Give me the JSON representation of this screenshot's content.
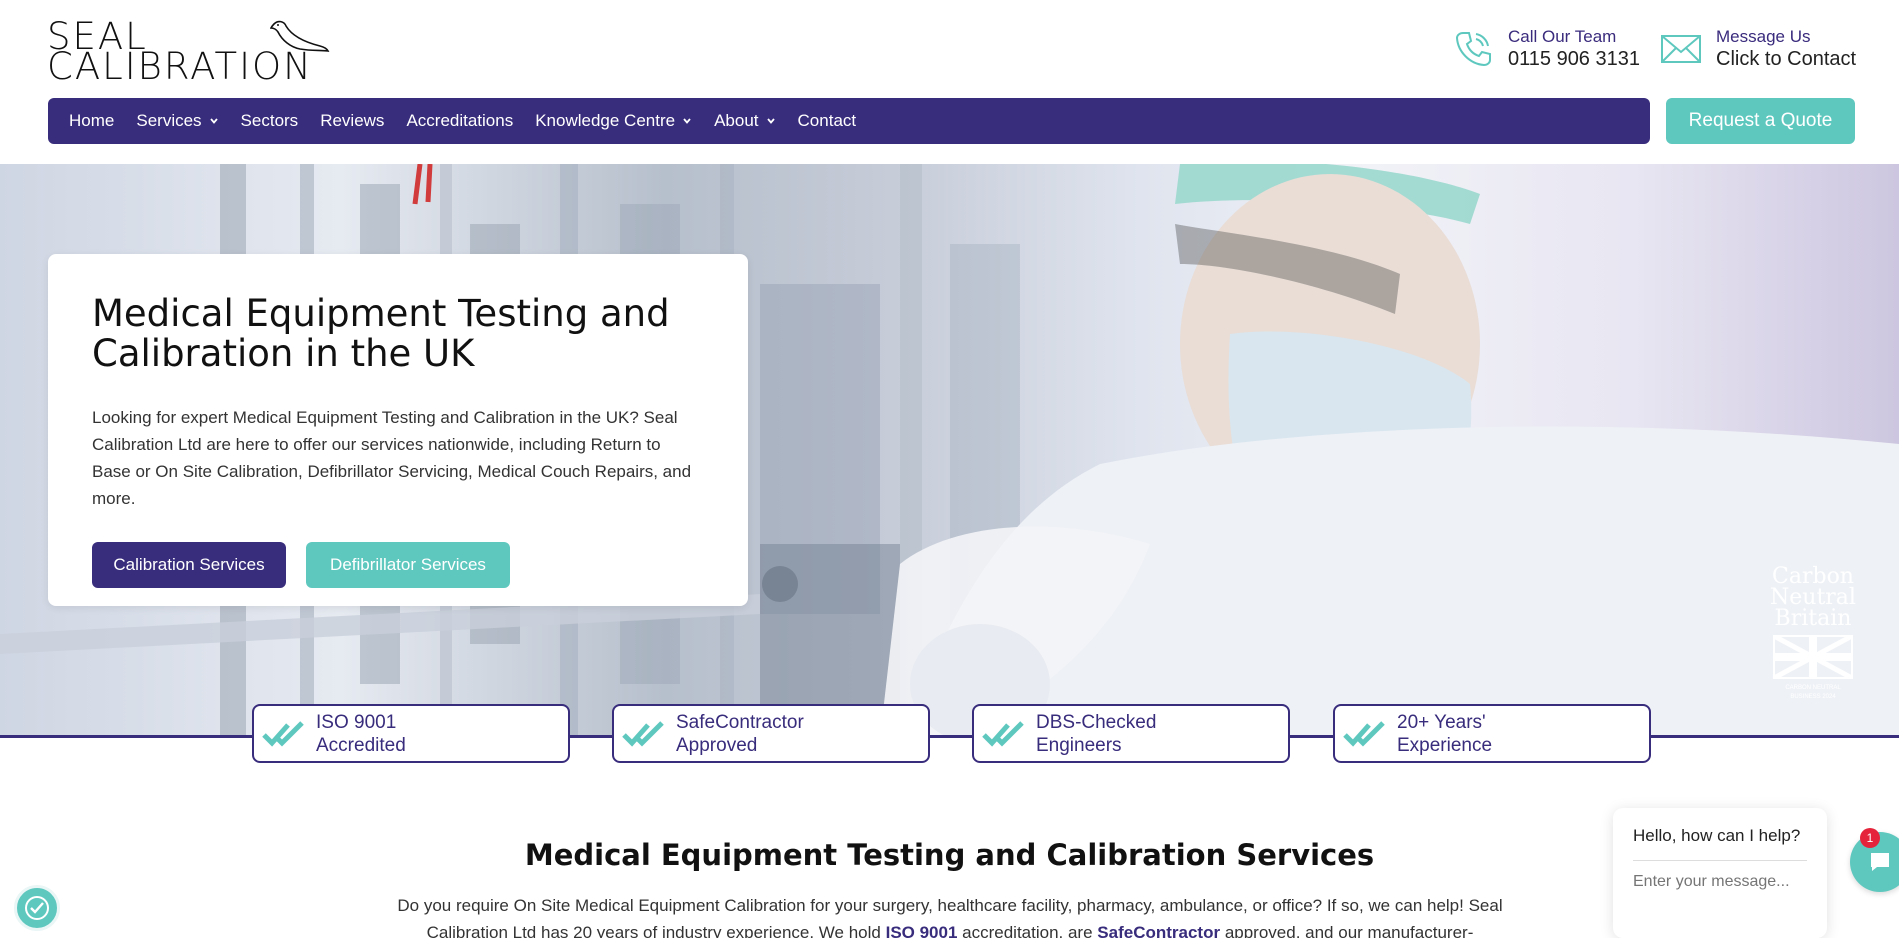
{
  "brand": {
    "logo_line1": "SEAL",
    "logo_line2": "CALIBRATION",
    "primary_color": "#382c7c",
    "accent_color": "#5ec8bf"
  },
  "header": {
    "call": {
      "label": "Call Our Team",
      "value": "0115 906 3131",
      "icon": "phone-icon"
    },
    "message": {
      "label": "Message Us",
      "value": "Click to Contact",
      "icon": "mail-icon"
    }
  },
  "nav": {
    "items": [
      {
        "label": "Home",
        "has_dropdown": false
      },
      {
        "label": "Services",
        "has_dropdown": true
      },
      {
        "label": "Sectors",
        "has_dropdown": false
      },
      {
        "label": "Reviews",
        "has_dropdown": false
      },
      {
        "label": "Accreditations",
        "has_dropdown": false
      },
      {
        "label": "Knowledge Centre",
        "has_dropdown": true
      },
      {
        "label": "About",
        "has_dropdown": true
      },
      {
        "label": "Contact",
        "has_dropdown": false
      }
    ],
    "quote_button": "Request a Quote"
  },
  "hero": {
    "title": "Medical Equipment Testing and Calibration in the UK",
    "text": "Looking for expert Medical Equipment Testing and Calibration in the UK? Seal Calibration Ltd are here to offer our services nationwide, including Return to Base or On Site Calibration, Defibrillator Servicing, Medical Couch Repairs, and more.",
    "primary_button": "Calibration Services",
    "secondary_button": "Defibrillator Services",
    "badge": {
      "line1": "Carbon",
      "line2": "Neutral",
      "line3": "Britain",
      "sub1": "CARBON NEUTRAL",
      "sub2": "BUSINESS 2024"
    }
  },
  "trust_badges": [
    {
      "line1": "ISO 9001",
      "line2": "Accredited"
    },
    {
      "line1": "SafeContractor",
      "line2": "Approved"
    },
    {
      "line1": "DBS-Checked",
      "line2": "Engineers"
    },
    {
      "line1": "20+ Years'",
      "line2": "Experience"
    }
  ],
  "services": {
    "title": "Medical Equipment Testing and Calibration Services",
    "text_part1": "Do you require On Site Medical Equipment Calibration for your surgery, healthcare facility, pharmacy, ambulance, or office? If so, we can help! Seal Calibration Ltd has 20 years of industry experience. We hold ",
    "link1": "ISO 9001",
    "text_part2": " accreditation, are ",
    "link2": "SafeContractor",
    "text_part3": " approved, and our manufacturer-"
  },
  "chat": {
    "greeting": "Hello, how can I help?",
    "placeholder": "Enter your message...",
    "badge_count": "1"
  }
}
